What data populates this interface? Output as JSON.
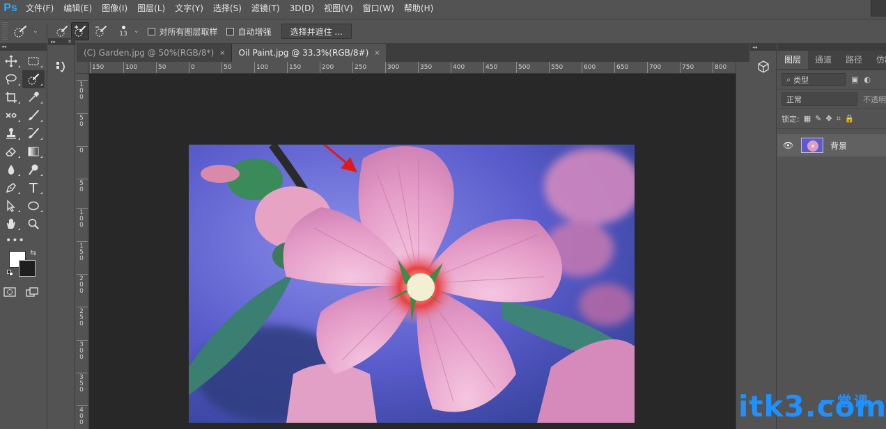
{
  "app": {
    "logo": "Ps"
  },
  "menu": [
    "文件(F)",
    "编辑(E)",
    "图像(I)",
    "图层(L)",
    "文字(Y)",
    "选择(S)",
    "滤镜(T)",
    "3D(D)",
    "视图(V)",
    "窗口(W)",
    "帮助(H)"
  ],
  "options": {
    "brush_size": "13",
    "sample_all_label": "对所有图层取样",
    "auto_enhance_label": "自动增强",
    "select_mask_label": "选择并遮住 ..."
  },
  "tabs": [
    {
      "label": "(C) Garden.jpg @ 50%(RGB/8*)",
      "close": "×"
    },
    {
      "label": "Oil Paint.jpg @ 33.3%(RGB/8#)",
      "close": "×"
    }
  ],
  "ruler_h": [
    "150",
    "100",
    "50",
    "0",
    "50",
    "100",
    "150",
    "200",
    "250",
    "300",
    "350",
    "400",
    "450",
    "500",
    "550",
    "600",
    "650",
    "700",
    "750",
    "800"
  ],
  "ruler_v": [
    "100",
    "50",
    "0",
    "50",
    "100",
    "150",
    "200",
    "250",
    "300",
    "350",
    "400"
  ],
  "layers_panel": {
    "tabs": [
      "图层",
      "通道",
      "路径",
      "仿制"
    ],
    "filter_label": "类型",
    "blend_mode": "正常",
    "opacity_label": "不透明",
    "lock_label": "锁定:",
    "layer_name": "背景"
  },
  "icons": {
    "brush_preset": "quick-selection-brush-icon",
    "new_selection": "new-selection-brush-icon",
    "add_selection": "add-to-selection-brush-icon",
    "subtract_selection": "subtract-selection-brush-icon"
  },
  "colors": {
    "foreground": "#ffffff",
    "background": "#1f1f1f",
    "accent": "#31a8ff",
    "annotation_arrow": "#e0191b"
  },
  "watermark": {
    "main": "itk3.com",
    "sub": "一堂课"
  }
}
